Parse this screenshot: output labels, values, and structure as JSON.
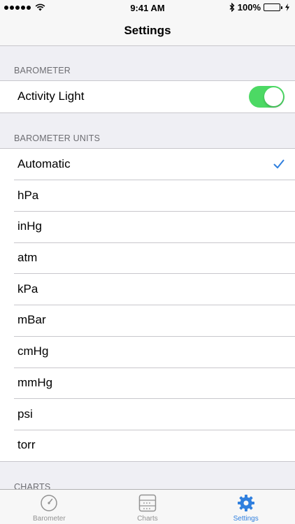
{
  "status_bar": {
    "time": "9:41 AM",
    "battery_text": "100%",
    "battery_level": 1.0
  },
  "nav": {
    "title": "Settings"
  },
  "sections": {
    "barometer": {
      "header": "BAROMETER",
      "activity_light": {
        "label": "Activity Light",
        "on": true
      }
    },
    "units": {
      "header": "BAROMETER UNITS",
      "items": [
        "Automatic",
        "hPa",
        "inHg",
        "atm",
        "kPa",
        "mBar",
        "cmHg",
        "mmHg",
        "psi",
        "torr"
      ],
      "selected": "Automatic"
    },
    "charts": {
      "header": "CHARTS"
    }
  },
  "tabs": [
    {
      "label": "Barometer",
      "icon": "gauge-icon",
      "active": false
    },
    {
      "label": "Charts",
      "icon": "chart-icon",
      "active": false
    },
    {
      "label": "Settings",
      "icon": "gear-icon",
      "active": true
    }
  ],
  "colors": {
    "accent": "#2f7fde",
    "toggle_on": "#4cd964",
    "battery": "#4cd964"
  }
}
